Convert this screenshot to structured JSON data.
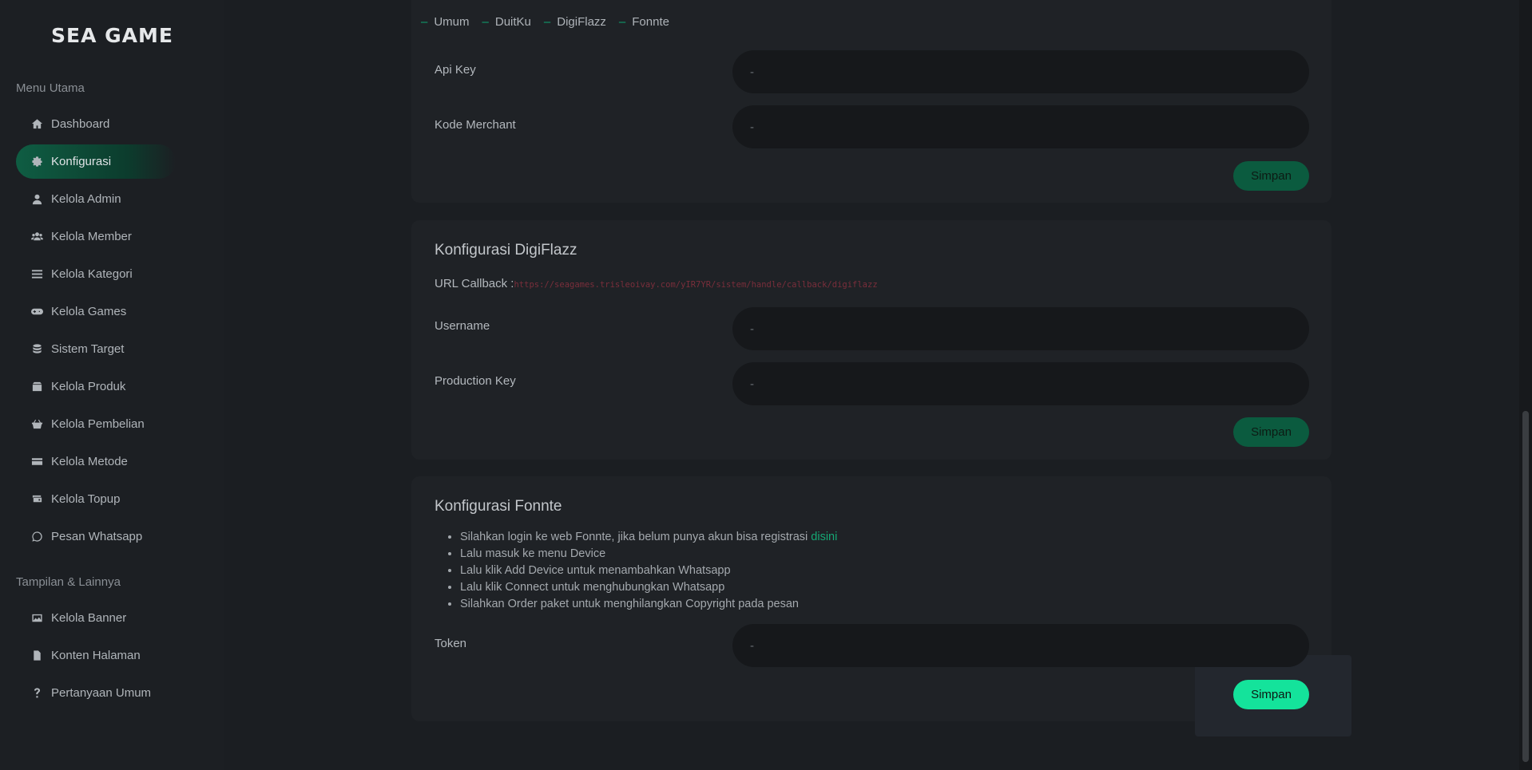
{
  "brand": {
    "logo_text": "SEA GAME"
  },
  "sidebar": {
    "section_main": "Menu Utama",
    "section_other": "Tampilan & Lainnya",
    "items": [
      {
        "label": "Dashboard",
        "icon": "home-icon"
      },
      {
        "label": "Konfigurasi",
        "icon": "gear-icon",
        "active": true
      },
      {
        "label": "Kelola Admin",
        "icon": "user-icon"
      },
      {
        "label": "Kelola Member",
        "icon": "users-icon"
      },
      {
        "label": "Kelola Kategori",
        "icon": "list-icon"
      },
      {
        "label": "Kelola Games",
        "icon": "gamepad-icon"
      },
      {
        "label": "Sistem Target",
        "icon": "database-icon"
      },
      {
        "label": "Kelola Produk",
        "icon": "box-icon"
      },
      {
        "label": "Kelola Pembelian",
        "icon": "basket-icon"
      },
      {
        "label": "Kelola Metode",
        "icon": "credit-card-icon"
      },
      {
        "label": "Kelola Topup",
        "icon": "wallet-icon"
      },
      {
        "label": "Pesan Whatsapp",
        "icon": "whatsapp-icon"
      }
    ],
    "other_items": [
      {
        "label": "Kelola Banner",
        "icon": "image-icon"
      },
      {
        "label": "Konten Halaman",
        "icon": "file-icon"
      },
      {
        "label": "Pertanyaan Umum",
        "icon": "question-icon"
      }
    ]
  },
  "tabs": [
    "Umum",
    "DuitKu",
    "DigiFlazz",
    "Fonnte"
  ],
  "duitku": {
    "api_key_label": "Api Key",
    "api_key_value": "-",
    "merchant_label": "Kode Merchant",
    "merchant_value": "-",
    "save_label": "Simpan"
  },
  "digiflazz": {
    "title": "Konfigurasi DigiFlazz",
    "callback_label": "URL Callback :",
    "callback_url": "https://seagames.trisleoivay.com/yIR7YR/sistem/handle/callback/digiflazz",
    "username_label": "Username",
    "username_value": "-",
    "prodkey_label": "Production Key",
    "prodkey_value": "-",
    "save_label": "Simpan"
  },
  "fonnte": {
    "title": "Konfigurasi Fonnte",
    "steps": [
      "Silahkan login ke web Fonnte, jika belum punya akun bisa registrasi ",
      "Lalu masuk ke menu Device",
      "Lalu klik Add Device untuk menambahkan Whatsapp",
      "Lalu klik Connect untuk menghubungkan Whatsapp",
      "Silahkan Order paket untuk menghilangkan Copyright pada pesan"
    ],
    "register_link": "disini",
    "token_label": "Token",
    "token_value": "-",
    "save_label": "Simpan"
  },
  "colors": {
    "accent": "#14e39b",
    "accent_dim": "#0b5b3f",
    "active_nav": "#0f5d43"
  }
}
